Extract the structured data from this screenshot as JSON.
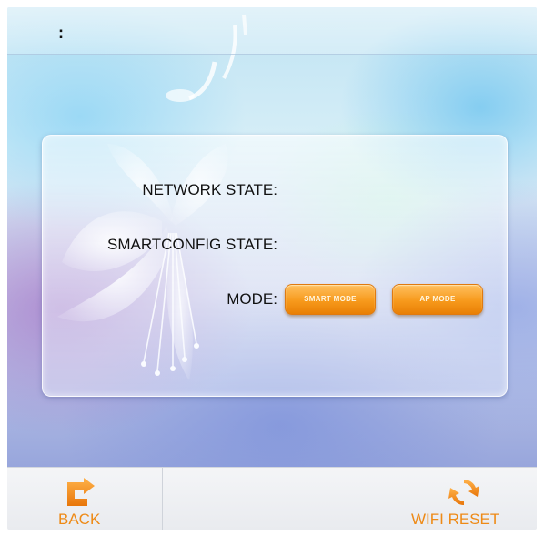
{
  "status_bar": {
    "text": ":"
  },
  "panel": {
    "network_state_label": "NETWORK STATE:",
    "smartconfig_state_label": "SMARTCONFIG STATE:",
    "mode_label": "MODE:",
    "smart_mode_button": "SMART MODE",
    "ap_mode_button": "AP MODE"
  },
  "bottom_bar": {
    "back_label": "BACK",
    "wifi_reset_label": "WIFI RESET",
    "back_icon": "return-arrow-icon",
    "reset_icon": "refresh-icon"
  },
  "colors": {
    "accent": "#f79a1c",
    "label_text": "#111111",
    "bottom_label": "#ee8a16"
  }
}
